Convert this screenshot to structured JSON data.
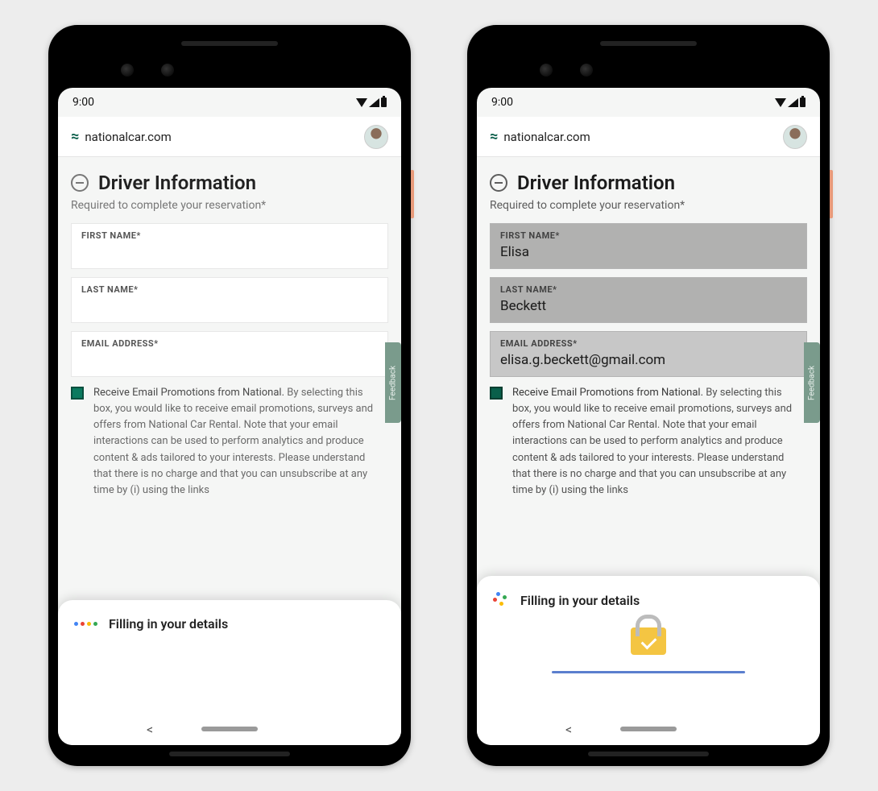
{
  "status": {
    "time": "9:00"
  },
  "urlbar": {
    "domain": "nationalcar.com"
  },
  "page": {
    "heading": "Driver Information",
    "subheading": "Required to complete your reservation*",
    "fields": {
      "first_name_label": "FIRST NAME*",
      "last_name_label": "LAST NAME*",
      "email_label": "EMAIL ADDRESS*"
    },
    "filled": {
      "first_name": "Elisa",
      "last_name": "Beckett",
      "email": "elisa.g.beckett@gmail.com"
    },
    "promo": {
      "title": "Receive Email Promotions from National.",
      "body": "By selecting this box, you would like to receive email promotions, surveys and offers from National Car Rental. Note that your email interactions can be used to perform analytics and produce content & ads tailored to your interests. Please understand that there is no charge and that you can unsubscribe at any time by (i) using the links"
    },
    "feedback_tab": "Feedback"
  },
  "assistant": {
    "title": "Filling in your details"
  }
}
